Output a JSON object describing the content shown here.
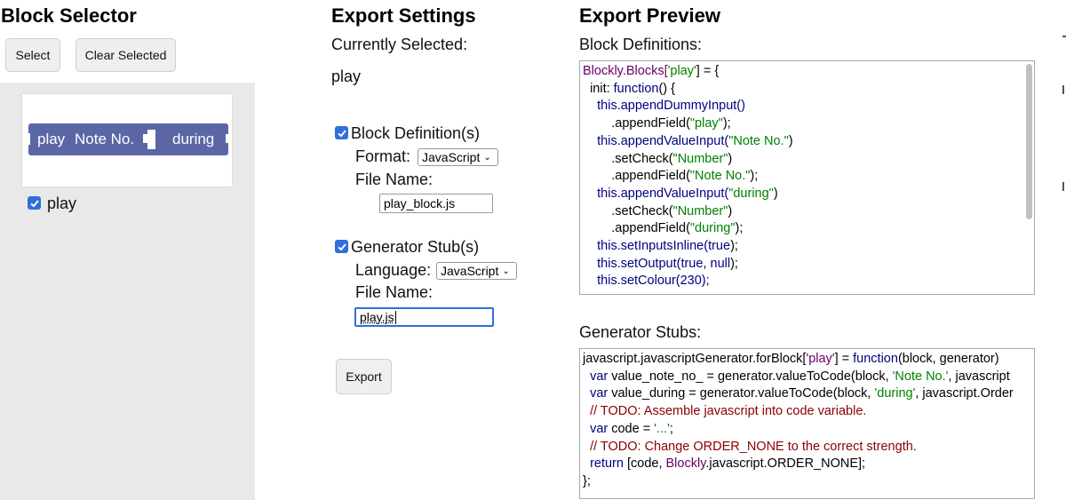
{
  "block_selector": {
    "title": "Block Selector",
    "select_label": "Select",
    "clear_label": "Clear Selected",
    "block": {
      "label_play": "play",
      "label_note": "Note No.",
      "label_during": "during",
      "color": "#5b67a5"
    },
    "item_label": "play",
    "item_checked": true
  },
  "export_settings": {
    "title": "Export Settings",
    "currently_selected_label": "Currently Selected:",
    "currently_selected_value": "play",
    "block_def_label": "Block Definition(s)",
    "block_def_checked": true,
    "format_label": "Format:",
    "format_value": "JavaScript",
    "file_name_label": "File Name:",
    "block_file_name": "play_block.js",
    "generator_label": "Generator Stub(s)",
    "generator_checked": true,
    "language_label": "Language:",
    "language_value": "JavaScript",
    "generator_file_name_label": "File Name:",
    "generator_file_name": "play.js",
    "export_label": "Export"
  },
  "export_preview": {
    "title": "Export Preview",
    "block_definitions_label": "Block Definitions:",
    "generator_stubs_label": "Generator Stubs:",
    "definitions": {
      "l1a": "Blockly.Blocks[",
      "l1b": "'play'",
      "l1c": "] = {",
      "l2a": "init: ",
      "l2b": "function",
      "l2c": "() {",
      "l3a": "this",
      "l3b": ".appendDummyInput()",
      "l4a": ".appendField(",
      "l4b": "\"play\"",
      "l4c": ");",
      "l5a": "this",
      "l5b": ".appendValueInput(",
      "l5c": "\"Note No.\"",
      "l5d": ")",
      "l6a": ".setCheck(",
      "l6b": "\"Number\"",
      "l6c": ")",
      "l7a": ".appendField(",
      "l7b": "\"Note No.\"",
      "l7c": ");",
      "l8a": "this",
      "l8b": ".appendValueInput(",
      "l8c": "\"during\"",
      "l8d": ")",
      "l9a": ".setCheck(",
      "l9b": "\"Number\"",
      "l9c": ")",
      "l10a": ".appendField(",
      "l10b": "\"during\"",
      "l10c": ");",
      "l11a": "this",
      "l11b": ".setInputsInline(",
      "l11c": "true",
      "l11d": ");",
      "l12a": "this",
      "l12b": ".setOutput(",
      "l12c": "true",
      "l12d": ", ",
      "l12e": "null",
      "l12f": ");",
      "l13": "this.setColour(230);"
    },
    "stubs": {
      "l1a": "javascript.javascriptGenerator.forBlock[",
      "l1b": "'play'",
      "l1c": "] = ",
      "l1d": "function",
      "l1e": "(block, generator)",
      "l2a": "var",
      "l2b": " value_note_no_ = generator.valueToCode(block, ",
      "l2c": "'Note No.'",
      "l2d": ", javascript",
      "l3a": "var",
      "l3b": " value_during = generator.valueToCode(block, ",
      "l3c": "'during'",
      "l3d": ", javascript.Order",
      "l4": "// TODO: Assemble javascript into code variable.",
      "l5a": "var",
      "l5b": " code = ",
      "l5c": "'...'",
      "l5d": ";",
      "l6": "// TODO: Change ORDER_NONE to the correct strength.",
      "l7a": "return",
      "l7b": " [code, ",
      "l7c": "Blockly",
      "l7d": ".javascript.ORDER_NONE];",
      "l8": "};"
    }
  }
}
